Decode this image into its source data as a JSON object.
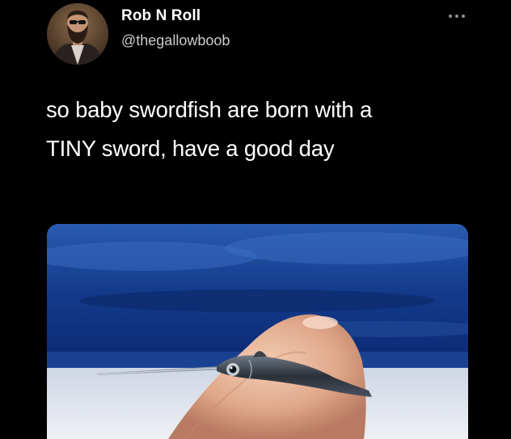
{
  "tweet": {
    "author": {
      "display_name": "Rob N Roll",
      "handle": "@thegallowboob",
      "avatar_icon": "bearded-man-avatar"
    },
    "more_icon": "more-horizontal-icon",
    "text_lines": [
      "so baby swordfish are born with a",
      "TINY sword, have a good day"
    ],
    "media": {
      "subject": "baby-swordfish-on-fingertip-photo"
    }
  },
  "colors": {
    "background": "#000000",
    "primary_text": "#ffffff",
    "secondary_text": "#c9cdd1",
    "icon_gray": "#8b9096"
  }
}
